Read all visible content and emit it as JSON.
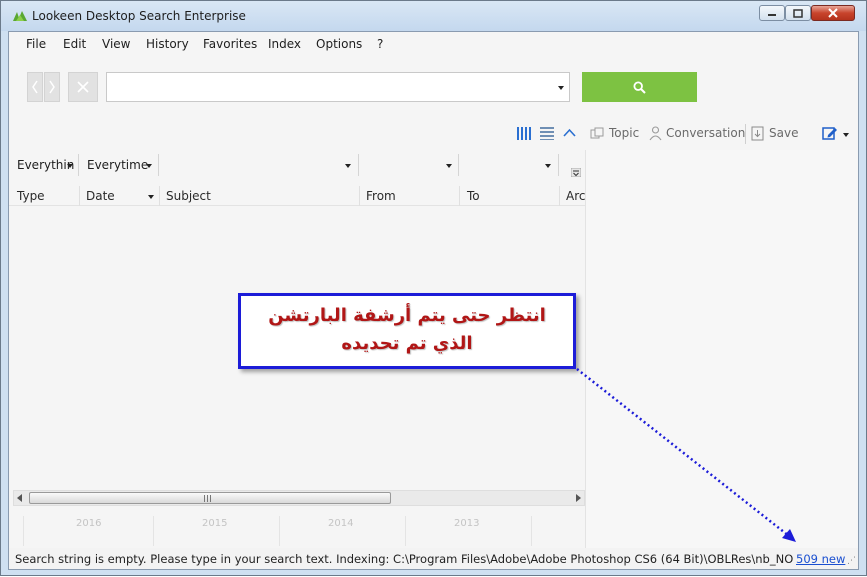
{
  "window": {
    "title": "Lookeen Desktop Search Enterprise"
  },
  "menu": {
    "items": [
      "File",
      "Edit",
      "View",
      "History",
      "Favorites",
      "Index",
      "Options",
      "?"
    ]
  },
  "search": {
    "value": "",
    "placeholder": ""
  },
  "toolbar": {
    "topic": "Topic",
    "conversation": "Conversation",
    "save": "Save"
  },
  "filters": {
    "scope": "Everythin",
    "time": "Everytime"
  },
  "columns": [
    "Type",
    "Date",
    "Subject",
    "From",
    "To",
    "Arc"
  ],
  "timeline": {
    "years": [
      "2016",
      "2015",
      "2014",
      "2013"
    ]
  },
  "status": {
    "message": "Search string is empty. Please type in your search text.  Indexing: C:\\Program Files\\Adobe\\Adobe Photoshop CS6 (64 Bit)\\OBLRes\\nb_NO",
    "new_count": "509 new"
  },
  "annotation": {
    "text": "انتظر حتى يتم أرشفة البارتشن الذي تم تحديده"
  },
  "colors": {
    "search_button": "#7dc242",
    "annotation_border": "#1c1cd8",
    "annotation_text": "#b11616",
    "link": "#1a4fd0"
  }
}
